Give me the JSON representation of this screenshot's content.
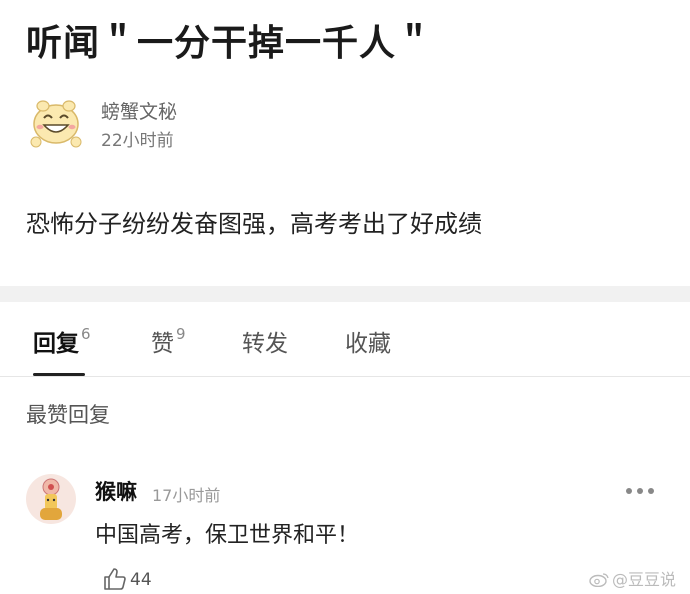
{
  "post": {
    "title": "听闻＂一分干掉一千人＂",
    "author": {
      "name": "螃蟹文秘",
      "time": "22小时前",
      "avatar_icon": "laughing-cartoon-avatar"
    },
    "content": "恐怖分子纷纷发奋图强，高考考出了好成绩"
  },
  "tabs": [
    {
      "label": "回复",
      "count": "6",
      "active": true
    },
    {
      "label": "赞",
      "count": "9"
    },
    {
      "label": "转发",
      "count": ""
    },
    {
      "label": "收藏",
      "count": ""
    }
  ],
  "section_title": "最赞回复",
  "comment": {
    "name": "猴嘛",
    "time": "17小时前",
    "text": "中国高考，保卫世界和平！",
    "likes": "44",
    "avatar_icon": "character-avatar"
  },
  "watermark": {
    "text": "@豆豆说",
    "icon": "weibo-icon"
  }
}
